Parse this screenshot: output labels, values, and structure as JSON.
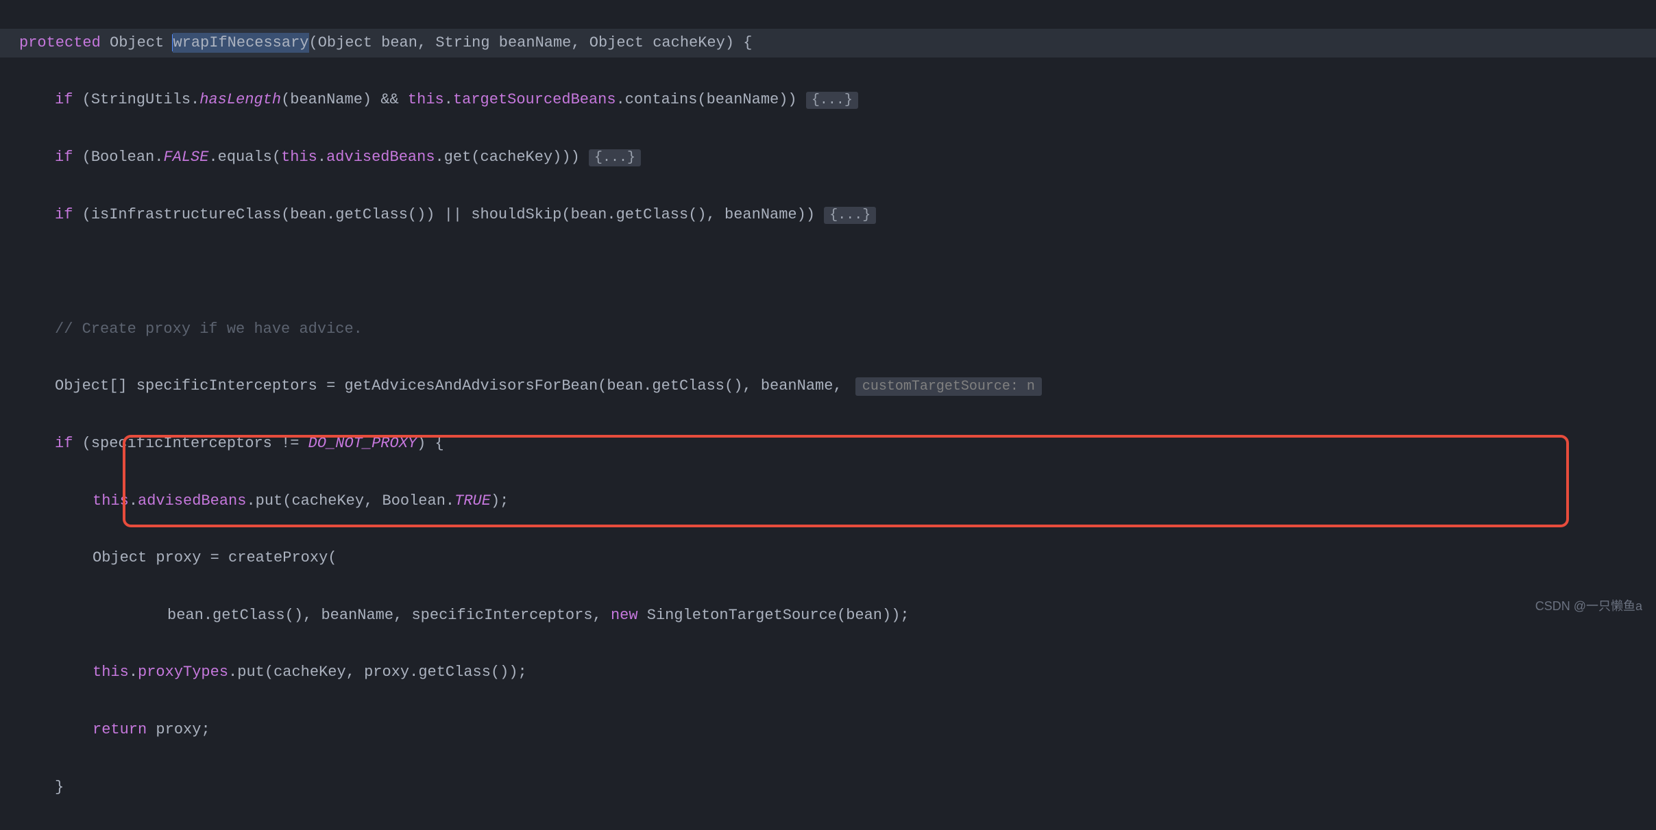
{
  "code": {
    "line1": {
      "kw_protected": "protected",
      "type_object1": "Object",
      "method": "wrapIfNecessary",
      "paren_open": "(",
      "type_object2": "Object",
      "param_bean": "bean",
      "comma1": ",",
      "type_string": "String",
      "param_beanname": "beanName",
      "comma2": ",",
      "type_object3": "Object",
      "param_cachekey": "cacheKey",
      "paren_close": ")",
      "brace": "{"
    },
    "line2": {
      "kw_if": "if",
      "paren_open": "(",
      "class_su": "StringUtils",
      "dot1": ".",
      "method_haslength": "hasLength",
      "paren_open2": "(",
      "param": "beanName",
      "paren_close2": ")",
      "and": "&&",
      "kw_this": "this",
      "dot2": ".",
      "field": "targetSourcedBeans",
      "dot3": ".",
      "method_contains": "contains",
      "paren_open3": "(",
      "param2": "beanName",
      "paren_close3": "))",
      "fold": "{...}"
    },
    "line3": {
      "kw_if": "if",
      "paren_open": "(",
      "class_bool": "Boolean",
      "dot1": ".",
      "const_false": "FALSE",
      "dot2": ".",
      "method_equals": "equals",
      "paren_open2": "(",
      "kw_this": "this",
      "dot3": ".",
      "field": "advisedBeans",
      "dot4": ".",
      "method_get": "get",
      "paren_open3": "(",
      "param": "cacheKey",
      "paren_close3": ")))",
      "fold": "{...}"
    },
    "line4": {
      "kw_if": "if",
      "paren_open": "(",
      "method_infra": "isInfrastructureClass",
      "paren_open2": "(",
      "param_bean": "bean",
      "dot1": ".",
      "method_getclass": "getClass",
      "paren_close2": "())",
      "or": "||",
      "method_skip": "shouldSkip",
      "paren_open3": "(",
      "param_bean2": "bean",
      "dot2": ".",
      "method_getclass2": "getClass",
      "paren_close3": "(),",
      "param_beanname": "beanName",
      "paren_close4": "))",
      "fold": "{...}"
    },
    "line5": {
      "comment": "// Create proxy if we have advice."
    },
    "line6": {
      "type_obj": "Object",
      "brackets": "[]",
      "var": "specificInterceptors",
      "eq": "=",
      "method": "getAdvicesAndAdvisorsForBean",
      "paren_open": "(",
      "param_bean": "bean",
      "dot": ".",
      "method_getclass": "getClass",
      "paren_close": "(),",
      "param_beanname": "beanName",
      "comma": ",",
      "hint": "customTargetSource: n"
    },
    "line7": {
      "kw_if": "if",
      "paren_open": "(",
      "var": "specificInterceptors",
      "neq": "!=",
      "const": "DO_NOT_PROXY",
      "paren_close": ")",
      "brace": "{"
    },
    "line8": {
      "kw_this": "this",
      "dot1": ".",
      "field": "advisedBeans",
      "dot2": ".",
      "method_put": "put",
      "paren_open": "(",
      "param1": "cacheKey",
      "comma": ",",
      "class_bool": "Boolean",
      "dot3": ".",
      "const_true": "TRUE",
      "paren_close": ");"
    },
    "line9": {
      "type_obj": "Object",
      "var": "proxy",
      "eq": "=",
      "method": "createProxy",
      "paren_open": "("
    },
    "line10": {
      "param_bean": "bean",
      "dot": ".",
      "method_getclass": "getClass",
      "paren_close1": "(),",
      "param_beanname": "beanName",
      "comma1": ",",
      "param_si": "specificInterceptors",
      "comma2": ",",
      "kw_new": "new",
      "class_sts": "SingletonTargetSource",
      "paren_open2": "(",
      "param_bean2": "bean",
      "paren_close2": "));"
    },
    "line11": {
      "kw_this": "this",
      "dot1": ".",
      "field": "proxyTypes",
      "dot2": ".",
      "method_put": "put",
      "paren_open": "(",
      "param1": "cacheKey",
      "comma": ",",
      "param2": "proxy",
      "dot3": ".",
      "method_getclass": "getClass",
      "paren_close": "());"
    },
    "line12": {
      "kw_return": "return",
      "var": "proxy",
      "semi": ";"
    },
    "line13": {
      "brace": "}"
    }
  },
  "watermark": "CSDN @一只懒鱼a"
}
